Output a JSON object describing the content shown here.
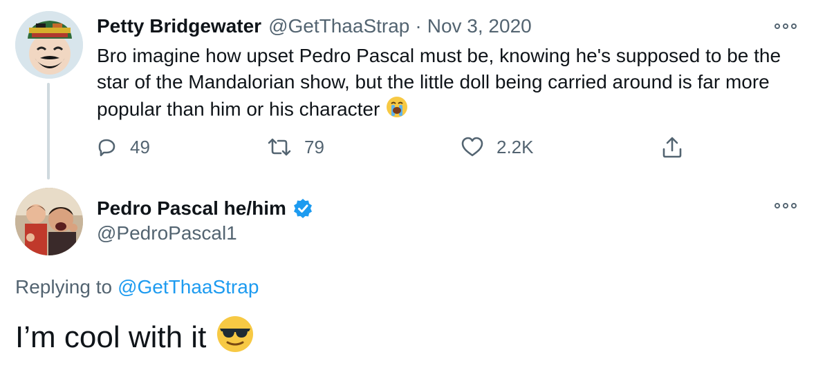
{
  "parent_tweet": {
    "display_name": "Petty Bridgewater",
    "handle": "@GetThaaStrap",
    "separator": "·",
    "date": "Nov 3, 2020",
    "text": "Bro imagine how upset Pedro Pascal must be, knowing he's supposed to be the star of the Mandalorian show, but the little doll being carried around is far more popular than him or his character",
    "text_emoji": "loudly-crying-face",
    "replies": "49",
    "retweets": "79",
    "likes": "2.2K",
    "icons": {
      "reply": "reply-icon",
      "retweet": "retweet-icon",
      "like": "heart-icon",
      "share": "share-icon",
      "more": "more-icon"
    }
  },
  "reply_tweet": {
    "display_name": "Pedro Pascal he/him",
    "verified": true,
    "handle": "@PedroPascal1",
    "replying_prefix": "Replying to",
    "replying_to": "@GetThaaStrap",
    "text": "I’m cool with it",
    "text_emoji": "smiling-face-with-sunglasses"
  },
  "colors": {
    "text": "#0f1419",
    "muted": "#536471",
    "link": "#1d9bf0",
    "verified": "#1d9bf0",
    "thread_line": "#cfd9de"
  }
}
